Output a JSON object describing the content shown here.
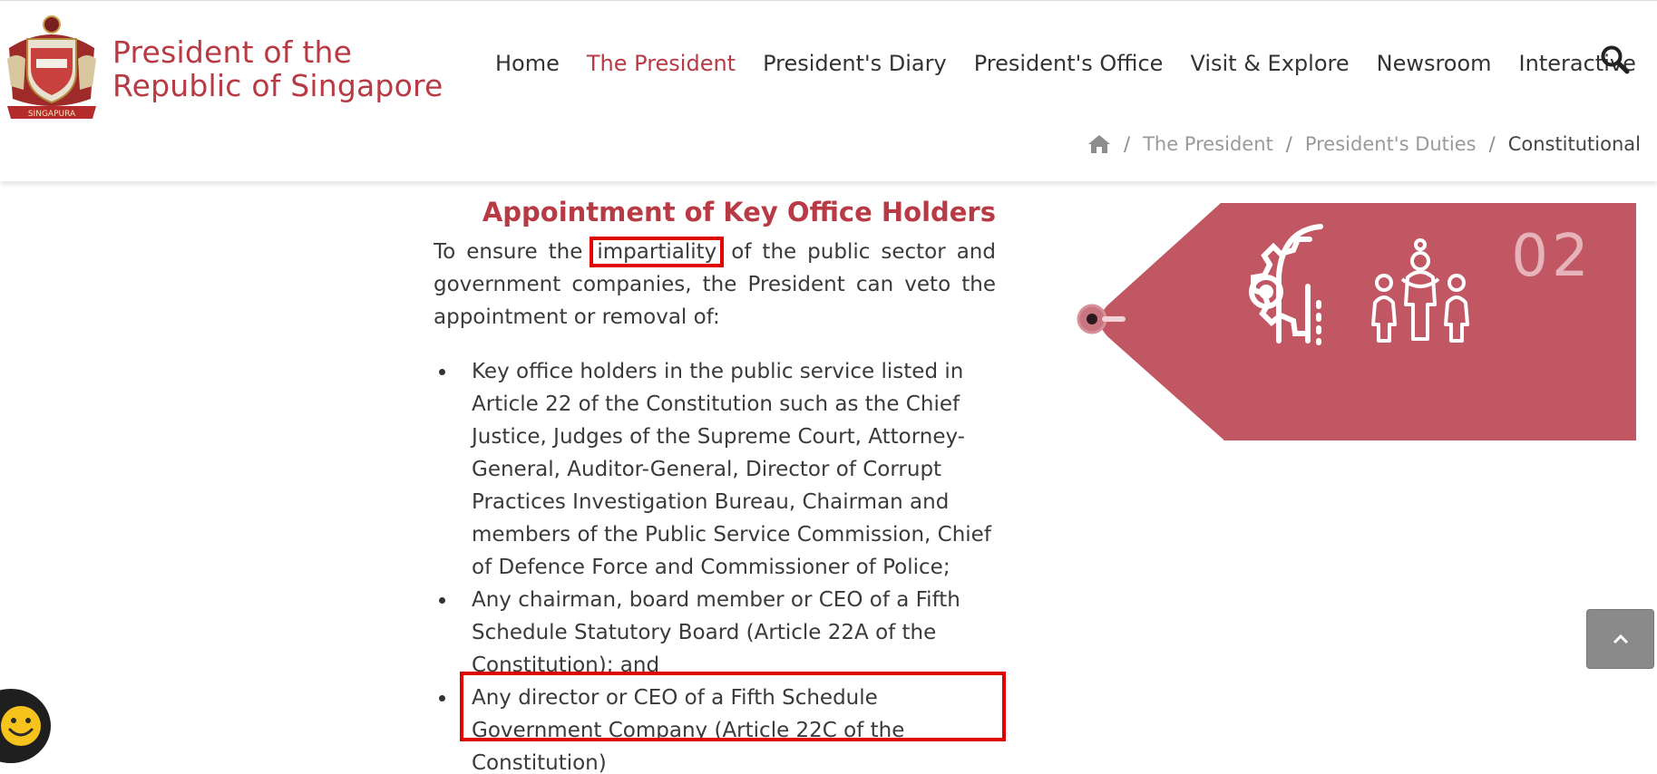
{
  "site": {
    "title_line1": "President of the",
    "title_line2": "Republic of Singapore",
    "logo_icon": "coat-of-arms-logo",
    "brand_color": "#b83a44"
  },
  "nav": {
    "items": [
      {
        "label": "Home",
        "active": false
      },
      {
        "label": "The President",
        "active": true
      },
      {
        "label": "President's Diary",
        "active": false
      },
      {
        "label": "President's Office",
        "active": false
      },
      {
        "label": "Visit & Explore",
        "active": false
      },
      {
        "label": "Newsroom",
        "active": false
      },
      {
        "label": "Interactive",
        "active": false
      }
    ],
    "search_icon": "search-icon"
  },
  "breadcrumb": {
    "home_icon": "home-icon",
    "separator": "/",
    "items": [
      "The President",
      "President's Duties"
    ],
    "current": "Constitutional"
  },
  "main": {
    "title": "Appointment of Key Office Holders",
    "intro_before": "To ensure the ",
    "intro_highlight": "impartiality",
    "intro_after": " of the public sector and government companies, the President can veto the appointment or removal of:",
    "list": [
      "Key office holders in the public service listed in Article 22 of the Constitution such as the Chief Justice, Judges of the Supreme Court, Attorney-General, Auditor-General, Director of Corrupt Practices Investigation Bureau, Chairman and members of the Public Service Commission, Chief of Defence Force and Commissioner of Police;",
      "Any chairman, board member or CEO of a Fifth Schedule Statutory Board (Article 22A of the Constitution); and",
      "Any director or CEO of a Fifth Schedule Government Company (Article 22C of the Constitution)"
    ]
  },
  "graphic": {
    "number": "02",
    "tag_color": "#c05762",
    "icons": [
      "gear-head-icon",
      "people-group-icon"
    ]
  },
  "floating": {
    "back_to_top_icon": "chevron-up-icon",
    "feedback_icon": "smiley-icon"
  },
  "annotation_color": "#e00000"
}
